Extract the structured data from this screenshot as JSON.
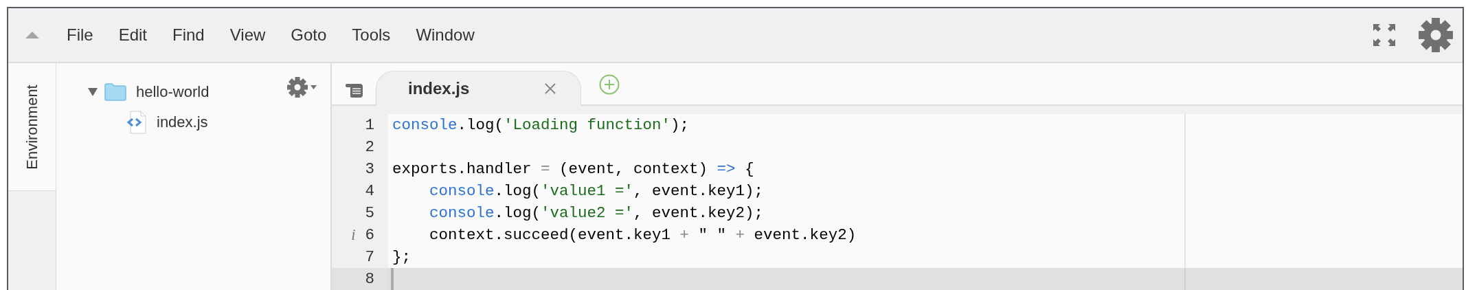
{
  "menu": {
    "items": [
      "File",
      "Edit",
      "Find",
      "View",
      "Goto",
      "Tools",
      "Window"
    ]
  },
  "sidebar": {
    "tabs": [
      {
        "label": "Environment",
        "selected": true
      }
    ]
  },
  "tree": [
    {
      "name": "hello-world",
      "kind": "folder",
      "expanded": true,
      "children": [
        {
          "name": "index.js",
          "kind": "file"
        }
      ]
    }
  ],
  "editor": {
    "tabs": [
      {
        "label": "index.js",
        "selected": true
      }
    ],
    "lines": [
      {
        "number": "1",
        "selected": false,
        "tokens": [
          {
            "kind": "builtin",
            "text": "console"
          },
          {
            "kind": "text",
            "text": ".log("
          },
          {
            "kind": "string",
            "text": "'Loading function'"
          },
          {
            "kind": "text",
            "text": ");"
          }
        ]
      },
      {
        "number": "2",
        "selected": false
      },
      {
        "number": "3",
        "selected": false,
        "tokens": [
          {
            "kind": "text",
            "text": "exports.handler "
          },
          {
            "kind": "operator",
            "text": "="
          },
          {
            "kind": "text",
            "text": " (event, context) "
          },
          {
            "kind": "keyword",
            "text": "=>"
          },
          {
            "kind": "text",
            "text": " {"
          }
        ]
      },
      {
        "number": "4",
        "selected": false,
        "indented": true,
        "tokens": [
          {
            "kind": "builtin",
            "text": "console"
          },
          {
            "kind": "text",
            "text": ".log("
          },
          {
            "kind": "string",
            "text": "'value1 ='"
          },
          {
            "kind": "text",
            "text": ", event.key1);"
          }
        ]
      },
      {
        "number": "5",
        "selected": false,
        "indented": true,
        "tokens": [
          {
            "kind": "builtin",
            "text": "console"
          },
          {
            "kind": "text",
            "text": ".log("
          },
          {
            "kind": "string",
            "text": "'value2 ='"
          },
          {
            "kind": "text",
            "text": ", event.key2);"
          }
        ]
      },
      {
        "number": "6",
        "selected": false,
        "indented": true,
        "annotation": "i",
        "tokens": [
          {
            "kind": "text",
            "text": "context.succeed(event.key1 "
          },
          {
            "kind": "operator",
            "text": "+"
          },
          {
            "kind": "text",
            "text": " \" \" "
          },
          {
            "kind": "operator",
            "text": "+"
          },
          {
            "kind": "text",
            "text": " event.key2)"
          }
        ]
      },
      {
        "number": "7",
        "selected": false,
        "tokens": [
          {
            "kind": "text",
            "text": "};"
          }
        ]
      },
      {
        "number": "8",
        "selected": true
      }
    ]
  }
}
